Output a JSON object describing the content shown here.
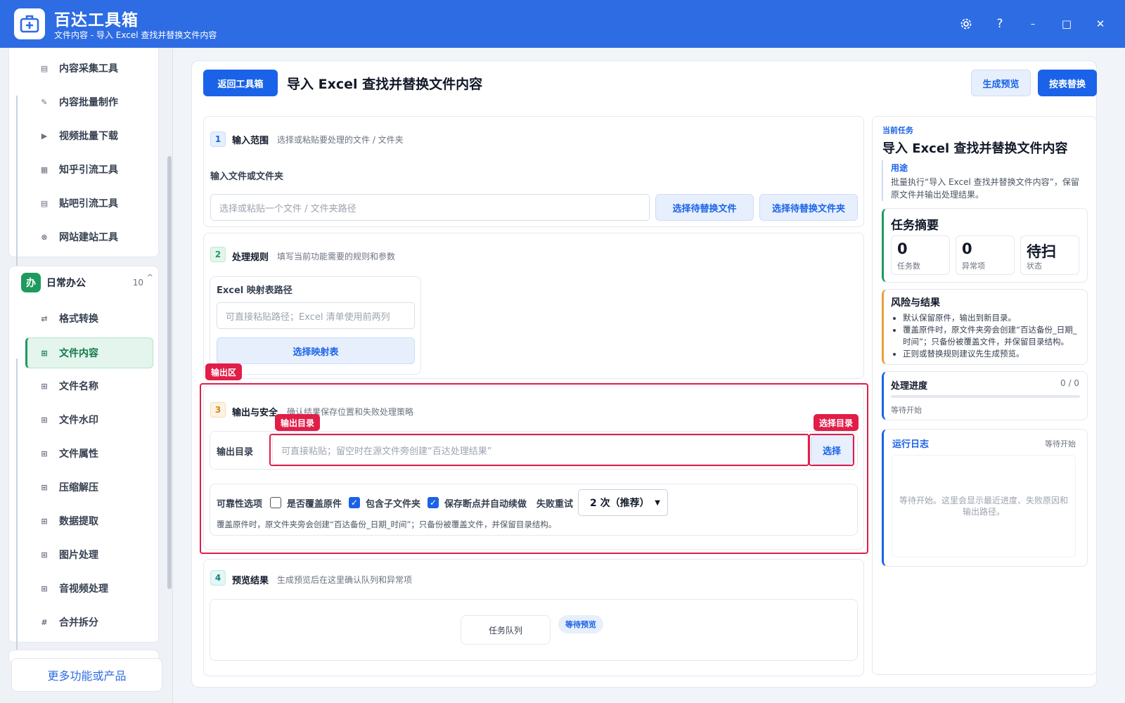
{
  "app": {
    "title": "百达工具箱",
    "subtitle": "文件内容 - 导入 Excel 查找并替换文件内容"
  },
  "window_controls": {
    "settings_icon": "gear-icon",
    "help": "?",
    "minimize": "–",
    "maximize": "□",
    "close": "✕"
  },
  "sidebar": {
    "top_items": [
      {
        "label": "内容采集工具",
        "icon": "▤"
      },
      {
        "label": "内容批量制作",
        "icon": "✎"
      },
      {
        "label": "视频批量下载",
        "icon": "▶"
      },
      {
        "label": "知乎引流工具",
        "icon": "▦"
      },
      {
        "label": "贴吧引流工具",
        "icon": "▤"
      },
      {
        "label": "网站建站工具",
        "icon": "⊗"
      }
    ],
    "group": {
      "badge": "办",
      "label": "日常办公",
      "count": "10",
      "caret": "^"
    },
    "group_items": [
      {
        "label": "格式转换",
        "icon": "⇄"
      },
      {
        "label": "文件内容",
        "icon": "⊞"
      },
      {
        "label": "文件名称",
        "icon": "⊞"
      },
      {
        "label": "文件水印",
        "icon": "⊞"
      },
      {
        "label": "文件属性",
        "icon": "⊞"
      },
      {
        "label": "压缩解压",
        "icon": "⊞"
      },
      {
        "label": "数据提取",
        "icon": "⊞"
      },
      {
        "label": "图片处理",
        "icon": "⊞"
      },
      {
        "label": "音视频处理",
        "icon": "⊞"
      },
      {
        "label": "合并拆分",
        "icon": "#"
      }
    ],
    "more_label": "更多功能或产品"
  },
  "header": {
    "back_label": "返回工具箱",
    "title": "导入 Excel 查找并替换文件内容",
    "preview_label": "生成预览",
    "run_label": "按表替换"
  },
  "steps": {
    "s1": {
      "num": "1",
      "title": "输入范围",
      "desc": "选择或粘贴要处理的文件 / 文件夹",
      "field_label": "输入文件或文件夹",
      "placeholder": "选择或粘贴一个文件 / 文件夹路径",
      "btn_file": "选择待替换文件",
      "btn_folder": "选择待替换文件夹"
    },
    "s2": {
      "num": "2",
      "title": "处理规则",
      "desc": "填写当前功能需要的规则和参数",
      "field_label": "Excel 映射表路径",
      "placeholder": "可直接粘贴路径；Excel 清单使用前两列",
      "btn": "选择映射表"
    },
    "s3": {
      "num": "3",
      "title": "输出与安全",
      "desc": "确认结果保存位置和失败处理策略",
      "tag_area": "输出区",
      "tag_dir": "输出目录",
      "tag_choose": "选择目录",
      "field_label": "输出目录",
      "placeholder": "可直接粘贴；留空时在源文件旁创建“百达处理结果”",
      "choose_btn": "选择",
      "reliability_label": "可靠性选项",
      "opt_overwrite": "是否覆盖原件",
      "opt_subfolder": "包含子文件夹",
      "opt_resume": "保存断点并自动续做",
      "retry_label": "失败重试",
      "retry_value": "2 次（推荐）",
      "note": "覆盖原件时，原文件夹旁会创建“百达备份_日期_时间”；只备份被覆盖文件，并保留目录结构。",
      "options_state": {
        "overwrite": false,
        "subfolder": true,
        "resume": true
      }
    },
    "s4": {
      "num": "4",
      "title": "预览结果",
      "desc": "生成预览后在这里确认队列和异常项",
      "queue_label": "任务队列",
      "status_badge": "等待预览"
    }
  },
  "right": {
    "current_label": "当前任务",
    "task_title": "导入 Excel 查找并替换文件内容",
    "purpose_label": "用途",
    "purpose_text": "批量执行“导入 Excel 查找并替换文件内容”，保留原文件并输出处理结果。",
    "summary_title": "任务摘要",
    "stats": [
      {
        "value": "0",
        "label": "任务数"
      },
      {
        "value": "0",
        "label": "异常项"
      },
      {
        "value": "待扫",
        "label": "状态"
      }
    ],
    "risk_title": "风险与结果",
    "risks": [
      "默认保留原件，输出到新目录。",
      "覆盖原件时，原文件夹旁会创建“百达备份_日期_时间”；只备份被覆盖文件，并保留目录结构。",
      "正则或替换规则建议先生成预览。"
    ],
    "progress_title": "处理进度",
    "progress_count": "0 / 0",
    "progress_value": 0,
    "progress_status": "等待开始",
    "log_title": "运行日志",
    "log_status": "等待开始",
    "log_placeholder": "等待开始。这里会显示最近进度、失败原因和输出路径。"
  },
  "colors": {
    "brand": "#2d6ce3",
    "primary": "#1a63e8",
    "green": "#1e9a5f",
    "alert": "#e11d48",
    "warn": "#e6a23c"
  }
}
